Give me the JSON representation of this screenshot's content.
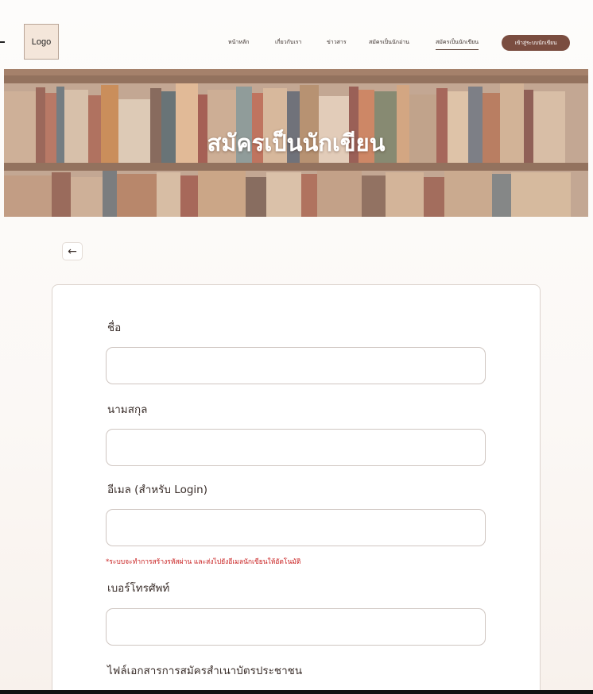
{
  "header": {
    "logo_label": "Logo",
    "nav": [
      {
        "label": "หน้าหลัก"
      },
      {
        "label": "เกี่ยวกับเรา"
      },
      {
        "label": "ข่าวสาร"
      },
      {
        "label": "สมัครเป็นนักอ่าน"
      },
      {
        "label": "สมัครเป็นนักเขียน",
        "active": true
      }
    ],
    "login_button": "เข้าสู่ระบบนักเขียน"
  },
  "hero": {
    "title": "สมัครเป็นนักเขียน"
  },
  "back_button": "←",
  "form": {
    "fields": [
      {
        "label": "ชื่อ",
        "value": ""
      },
      {
        "label": "นามสกุล",
        "value": ""
      },
      {
        "label": "อีเมล (สำหรับ Login)",
        "value": ""
      },
      {
        "label": "เบอร์โทรศัพท์",
        "value": ""
      }
    ],
    "email_note": "*ระบบจะทำการสร้างรหัสผ่าน และส่งไปยังอีเมลนักเขียนให้อัตโนมัติ",
    "id_card_label": "ไฟล์เอกสารการสมัครสำเนาบัตรประชาชน"
  },
  "colors": {
    "accent": "#7a4d40",
    "error": "#c81e1e",
    "logo_bg": "#f4e6da"
  }
}
